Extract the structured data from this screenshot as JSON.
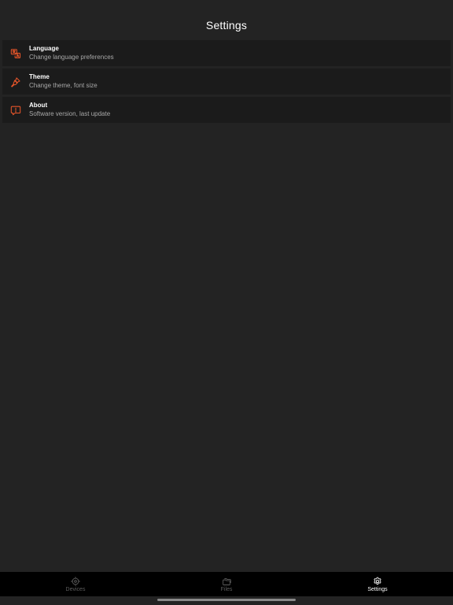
{
  "header": {
    "title": "Settings"
  },
  "settings": {
    "items": [
      {
        "title": "Language",
        "subtitle": "Change language preferences",
        "icon": "language-icon"
      },
      {
        "title": "Theme",
        "subtitle": "Change theme, font size",
        "icon": "brush-icon"
      },
      {
        "title": "About",
        "subtitle": "Software version, last update",
        "icon": "info-icon"
      }
    ]
  },
  "tab_bar": {
    "tabs": [
      {
        "label": "Devices",
        "icon": "devices-icon",
        "active": false
      },
      {
        "label": "Files",
        "icon": "files-icon",
        "active": false
      },
      {
        "label": "Settings",
        "icon": "gear-icon",
        "active": true
      }
    ]
  },
  "colors": {
    "accent": "#e8562a",
    "background": "#232323",
    "card": "#1b1b1b",
    "tab_bar": "#000000",
    "inactive_tab": "#5e5e5e"
  }
}
